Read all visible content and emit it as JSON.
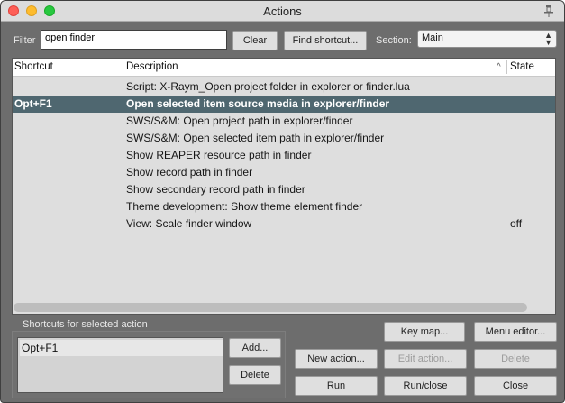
{
  "window": {
    "title": "Actions"
  },
  "filter": {
    "label": "Filter",
    "value": "open finder"
  },
  "buttons": {
    "clear": "Clear",
    "find_shortcut": "Find shortcut...",
    "key_map": "Key map...",
    "menu_editor": "Menu editor...",
    "new_action": "New action...",
    "edit_action": "Edit action...",
    "delete_action": "Delete",
    "run": "Run",
    "run_close": "Run/close",
    "close": "Close",
    "add": "Add...",
    "delete_shortcut": "Delete"
  },
  "section": {
    "label": "Section:",
    "value": "Main"
  },
  "table": {
    "headers": {
      "shortcut": "Shortcut",
      "description": "Description",
      "state": "State"
    },
    "rows": [
      {
        "shortcut": "",
        "description": "Script: X-Raym_Open project folder in explorer or finder.lua",
        "state": ""
      },
      {
        "shortcut": "Opt+F1",
        "description": "Open selected item source media in explorer/finder",
        "state": "",
        "selected": true
      },
      {
        "shortcut": "",
        "description": "SWS/S&M: Open project path in explorer/finder",
        "state": ""
      },
      {
        "shortcut": "",
        "description": "SWS/S&M: Open selected item path in explorer/finder",
        "state": ""
      },
      {
        "shortcut": "",
        "description": "Show REAPER resource path in finder",
        "state": ""
      },
      {
        "shortcut": "",
        "description": "Show record path in finder",
        "state": ""
      },
      {
        "shortcut": "",
        "description": "Show secondary record path in finder",
        "state": ""
      },
      {
        "shortcut": "",
        "description": "Theme development: Show theme element finder",
        "state": ""
      },
      {
        "shortcut": "",
        "description": "View: Scale finder window",
        "state": "off"
      }
    ]
  },
  "shortcuts_panel": {
    "label": "Shortcuts for selected action",
    "items": [
      "Opt+F1"
    ]
  },
  "colors": {
    "selection": "#4f6770",
    "window_bg": "#6d6d6d",
    "list_bg": "#dedede"
  }
}
